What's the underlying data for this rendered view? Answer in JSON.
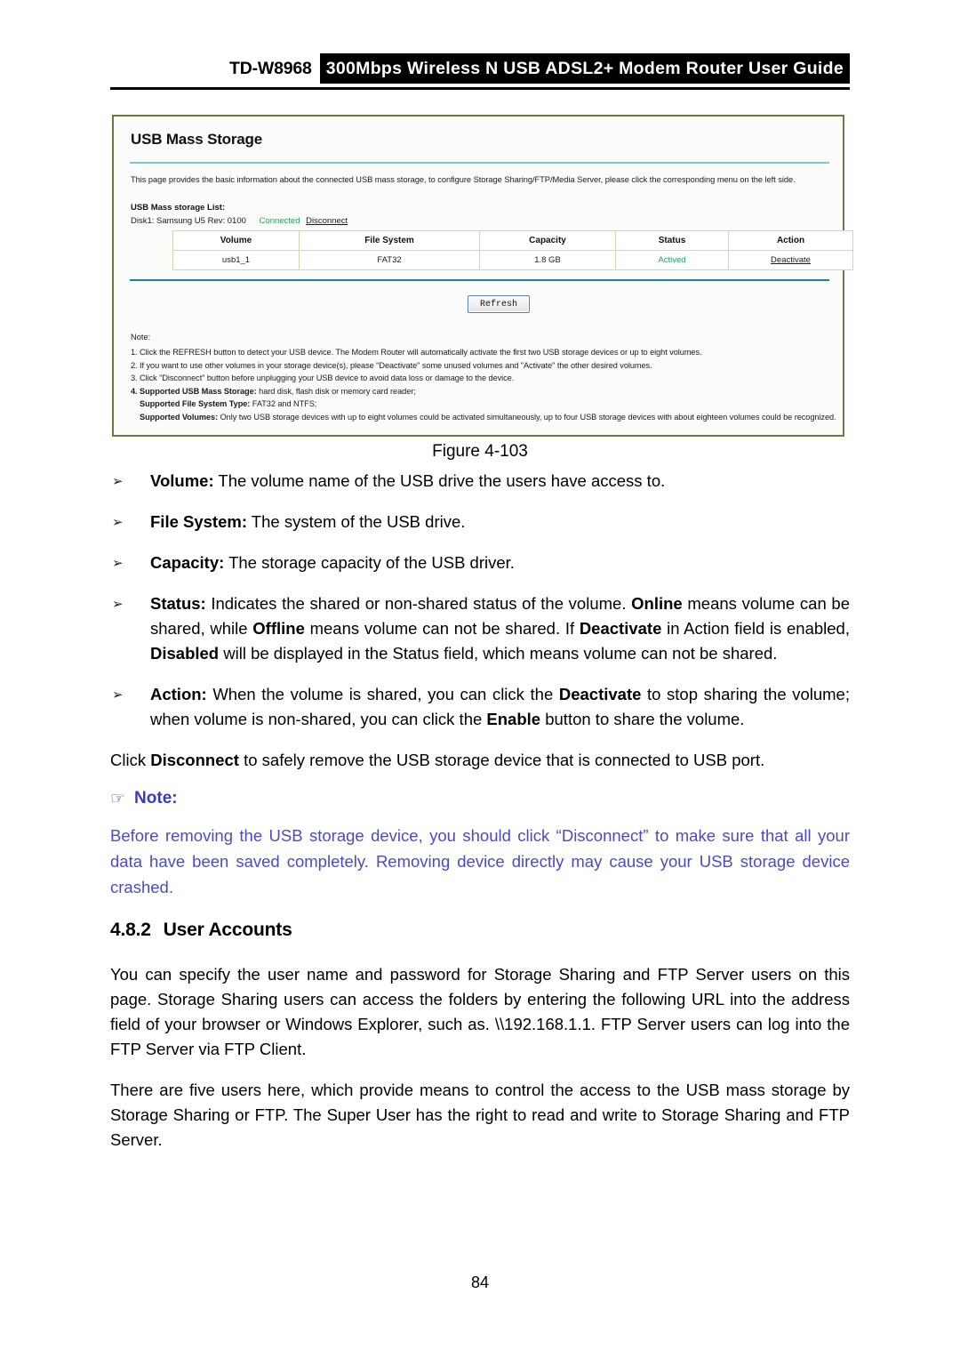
{
  "header": {
    "model": "TD-W8968",
    "banner": "300Mbps Wireless N USB ADSL2+ Modem Router User Guide"
  },
  "figure": {
    "panel_title": "USB Mass Storage",
    "intro": "This page provides the basic information about the connected USB mass storage, to configure Storage Sharing/FTP/Media Server, please click the corresponding menu on the left side.",
    "list_label": "USB Mass storage List:",
    "disk_name": "Disk1: Samsung U5 Rev: 0100",
    "disk_status": "Connected",
    "disk_action": "Disconnect",
    "table": {
      "headers": [
        "Volume",
        "File System",
        "Capacity",
        "Status",
        "Action"
      ],
      "rows": [
        {
          "volume": "usb1_1",
          "file_system": "FAT32",
          "capacity": "1.8 GB",
          "status": "Actived",
          "action": "Deactivate"
        }
      ]
    },
    "refresh_button": "Refresh",
    "note_label": "Note:",
    "notes": [
      "1. Click the REFRESH button to detect your USB device. The Modem Router will automatically activate the first two USB storage devices or up to eight volumes.",
      "2. If you want to use other volumes in your storage device(s), please \"Deactivate\" some unused volumes and \"Activate\" the other desired volumes.",
      "3. Click \"Disconnect\" button before unplugging your USB device to avoid data loss or damage to the device."
    ],
    "note4_label": "4. Supported USB Mass Storage:",
    "note4_text": " hard disk, flash disk or memory card reader;",
    "note5_label": "Supported File System Type:",
    "note5_text": " FAT32 and NTFS;",
    "note6_label": "Supported Volumes:",
    "note6_text": " Only two USB storage devices with up to eight volumes could be activated simultaneously, up to four USB storage devices with about eighteen volumes could be recognized.",
    "caption": "Figure 4-103"
  },
  "body": {
    "bullet_marker": "➢",
    "bullets": [
      {
        "term": "Volume:",
        "rest": " The volume name of the USB drive the users have access to."
      },
      {
        "term": "File System:",
        "rest": " The system of the USB drive."
      },
      {
        "term": "Capacity:",
        "rest": " The storage capacity of the USB driver."
      }
    ],
    "status_bullet": {
      "term": "Status:",
      "p1": " Indicates the shared or non-shared status of the volume. ",
      "b1": "Online",
      "p2": " means volume can be shared, while ",
      "b2": "Offline",
      "p3": " means volume can not be shared. If ",
      "b3": "Deactivate",
      "p4": " in Action field is enabled, ",
      "b4": "Disabled",
      "p5": " will be displayed in the Status field, which means volume can not be shared."
    },
    "action_bullet": {
      "term": "Action:",
      "p1": " When the volume is shared, you can click the ",
      "b1": "Deactivate",
      "p2": " to stop sharing the volume; when volume is non-shared, you can click the ",
      "b2": "Enable",
      "p3": " button to share the volume."
    },
    "disconnect_para": {
      "p1": "Click ",
      "b1": "Disconnect",
      "p2": " to safely remove the USB storage device that is connected to USB port."
    },
    "note": {
      "hand_icon": "☞",
      "label": "Note:",
      "text": "Before removing the USB storage device, you should click “Disconnect” to make sure that all your data have been saved completely. Removing device directly may cause your USB storage device crashed."
    },
    "section": {
      "number": "4.8.2",
      "title": "User Accounts"
    },
    "para_1": "You can specify the user name and password for Storage Sharing and FTP Server users on this page. Storage Sharing users can access the folders by entering the following URL into the address field of your browser or Windows Explorer, such as. \\\\192.168.1.1. FTP Server users can log into the FTP Server via FTP Client.",
    "para_2": "There are five users here, which provide means to control the access to the USB mass storage by Storage Sharing or FTP. The Super User has the right to read and write to Storage Sharing and FTP Server."
  },
  "footer": {
    "page_number": "84"
  },
  "colors": {
    "note_blue": "#4b4bc4",
    "status_green": "#23a05a",
    "panel_border": "#7b7142",
    "divider_teal": "#1583a8"
  }
}
